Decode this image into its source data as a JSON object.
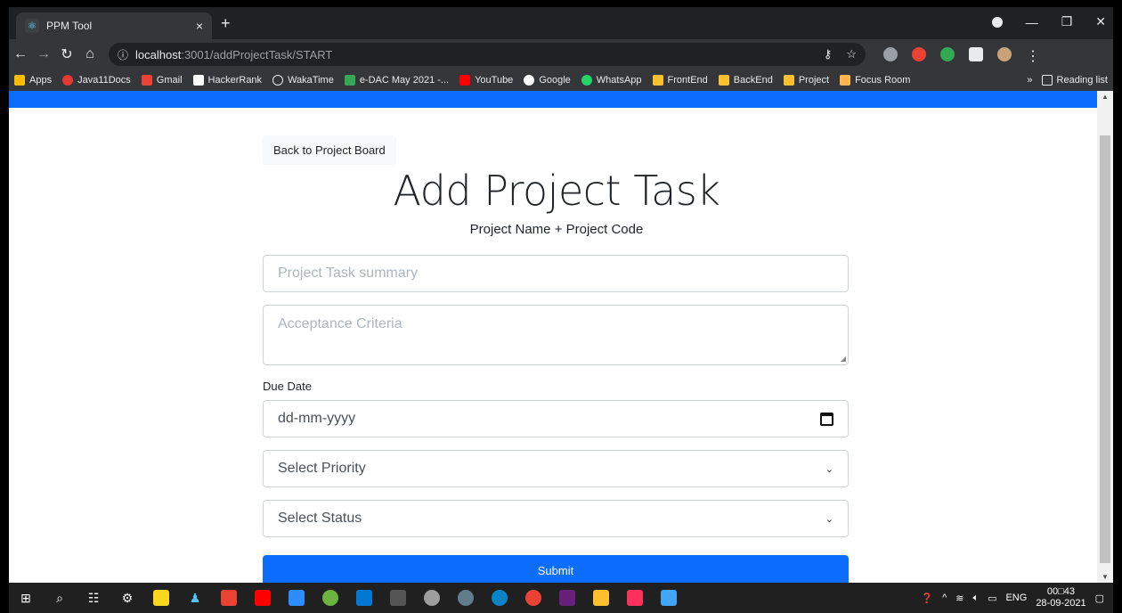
{
  "browser": {
    "tab_title": "PPM Tool",
    "tab_close": "×",
    "new_tab": "+",
    "url_host": "localhost",
    "url_path": ":3001/addProjectTask/START",
    "bookmarks": [
      "Apps",
      "Java11Docs",
      "Gmail",
      "HackerRank",
      "WakaTime",
      "e-DAC May 2021 -...",
      "YouTube",
      "Google",
      "WhatsApp",
      "FrontEnd",
      "BackEnd",
      "Project",
      "Focus Room"
    ],
    "more_bookmarks": "»",
    "reading_list": "Reading list"
  },
  "page": {
    "back_button": "Back to Project Board",
    "heading": "Add Project Task",
    "subheading": "Project Name + Project Code",
    "summary_placeholder": "Project Task summary",
    "criteria_placeholder": "Acceptance Criteria",
    "due_date_label": "Due Date",
    "due_date_value": "dd-mm-yyyy",
    "priority_select": "Select Priority",
    "status_select": "Select Status",
    "submit_label": "Submit"
  },
  "taskbar": {
    "lang": "ENG",
    "time": "00□43",
    "date": "28-09-2021"
  },
  "colors": {
    "primary": "#0d6efd",
    "browser_dark": "#35363a"
  }
}
